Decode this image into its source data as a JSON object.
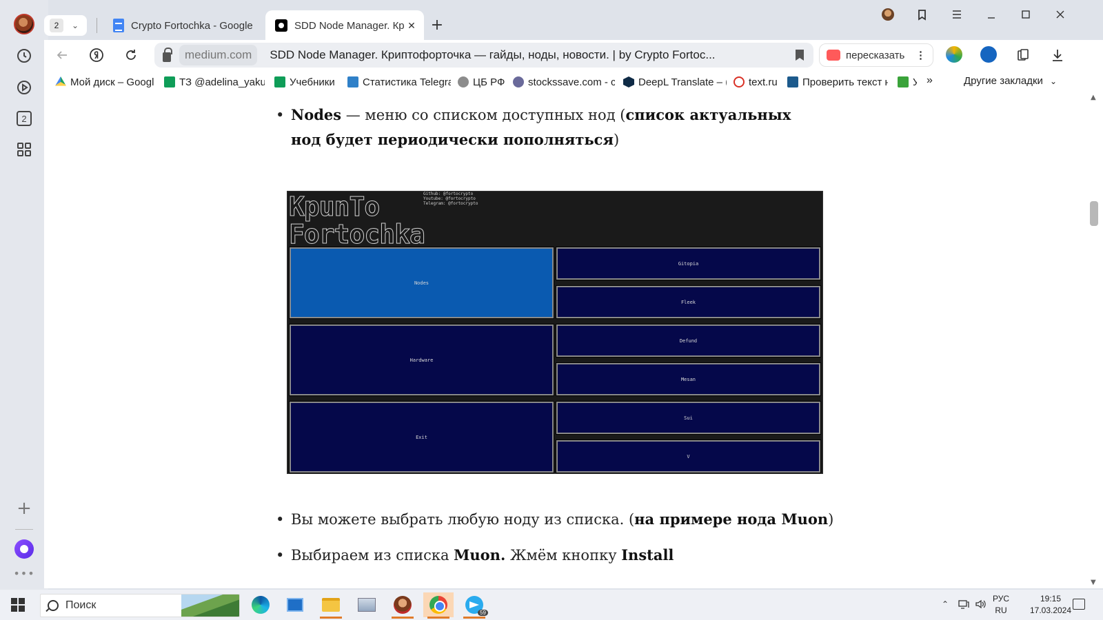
{
  "tabs": {
    "count": "2",
    "items": [
      {
        "title": "Crypto Fortochka - Google",
        "icon": "google-docs-icon",
        "active": false
      },
      {
        "title": "SDD Node Manager. Кр",
        "icon": "medium-icon",
        "active": true,
        "close": "✕"
      }
    ],
    "new_tab": "+"
  },
  "toolbar": {
    "domain": "medium.com",
    "page_title": "SDD Node Manager. Криптофорточка — гайды, ноды, новости. | by Crypto Fortoc...",
    "retell_label": "пересказать"
  },
  "bookmarks": {
    "items": [
      {
        "label": "Мой диск – Googl",
        "icon_color": "#1fa463"
      },
      {
        "label": "ТЗ @adelina_yaku",
        "icon_color": "#0f9d58"
      },
      {
        "label": "Учебники",
        "icon_color": "#0f9d58"
      },
      {
        "label": "Статистика Telegra",
        "icon_color": "#2f80c8"
      },
      {
        "label": "ЦБ РФ",
        "icon_color": "#8c8c8c"
      },
      {
        "label": "stockssave.com - c",
        "icon_color": "#6a6a9a"
      },
      {
        "label": "DeepL Translate – (",
        "icon_color": "#0f2b46"
      },
      {
        "label": "text.ru",
        "icon_color": "#d93025"
      },
      {
        "label": "Проверить текст н",
        "icon_color": "#1c5a8c"
      },
      {
        "label": "У",
        "icon_color": "#3aa33a"
      }
    ],
    "more": "»",
    "other": "Другие закладки"
  },
  "article": {
    "li1_bold": "Nodes",
    "li1_text": " — меню со списком доступных нод (",
    "li1_bold2": "список актуальных нод будет периодически пополняться",
    "li1_end": ")",
    "li2_text": "Вы можете выбрать любую ноду из списка. (",
    "li2_bold": "на примере нода Muon",
    "li2_end": ")",
    "li3_text": "Выбираем из списка ",
    "li3_bold": "Muon.",
    "li3_text2": " Жмём кнопку ",
    "li3_bold2": "Install"
  },
  "terminal": {
    "logo_line1": "KpunTo",
    "logo_line2": "Fortochka",
    "info": [
      "Github: @fortocrypto",
      "Youtube: @fortocrypto",
      "Telegram: @fortocrypto"
    ],
    "left_buttons": [
      "Nodes",
      "Hardware",
      "Exit"
    ],
    "right_buttons": [
      "Gitopia",
      "Fleek",
      "Defund",
      "Mesan",
      "Sui",
      "V"
    ],
    "selected": "Nodes",
    "colors": {
      "background": "#1a1a1a",
      "button": "#05084a",
      "selected": "#0a5ab0"
    }
  },
  "taskbar": {
    "search_placeholder": "Поиск",
    "telegram_badge": "59",
    "lang_top": "РУС",
    "lang_bottom": "RU",
    "time": "19:15",
    "date": "17.03.2024"
  }
}
